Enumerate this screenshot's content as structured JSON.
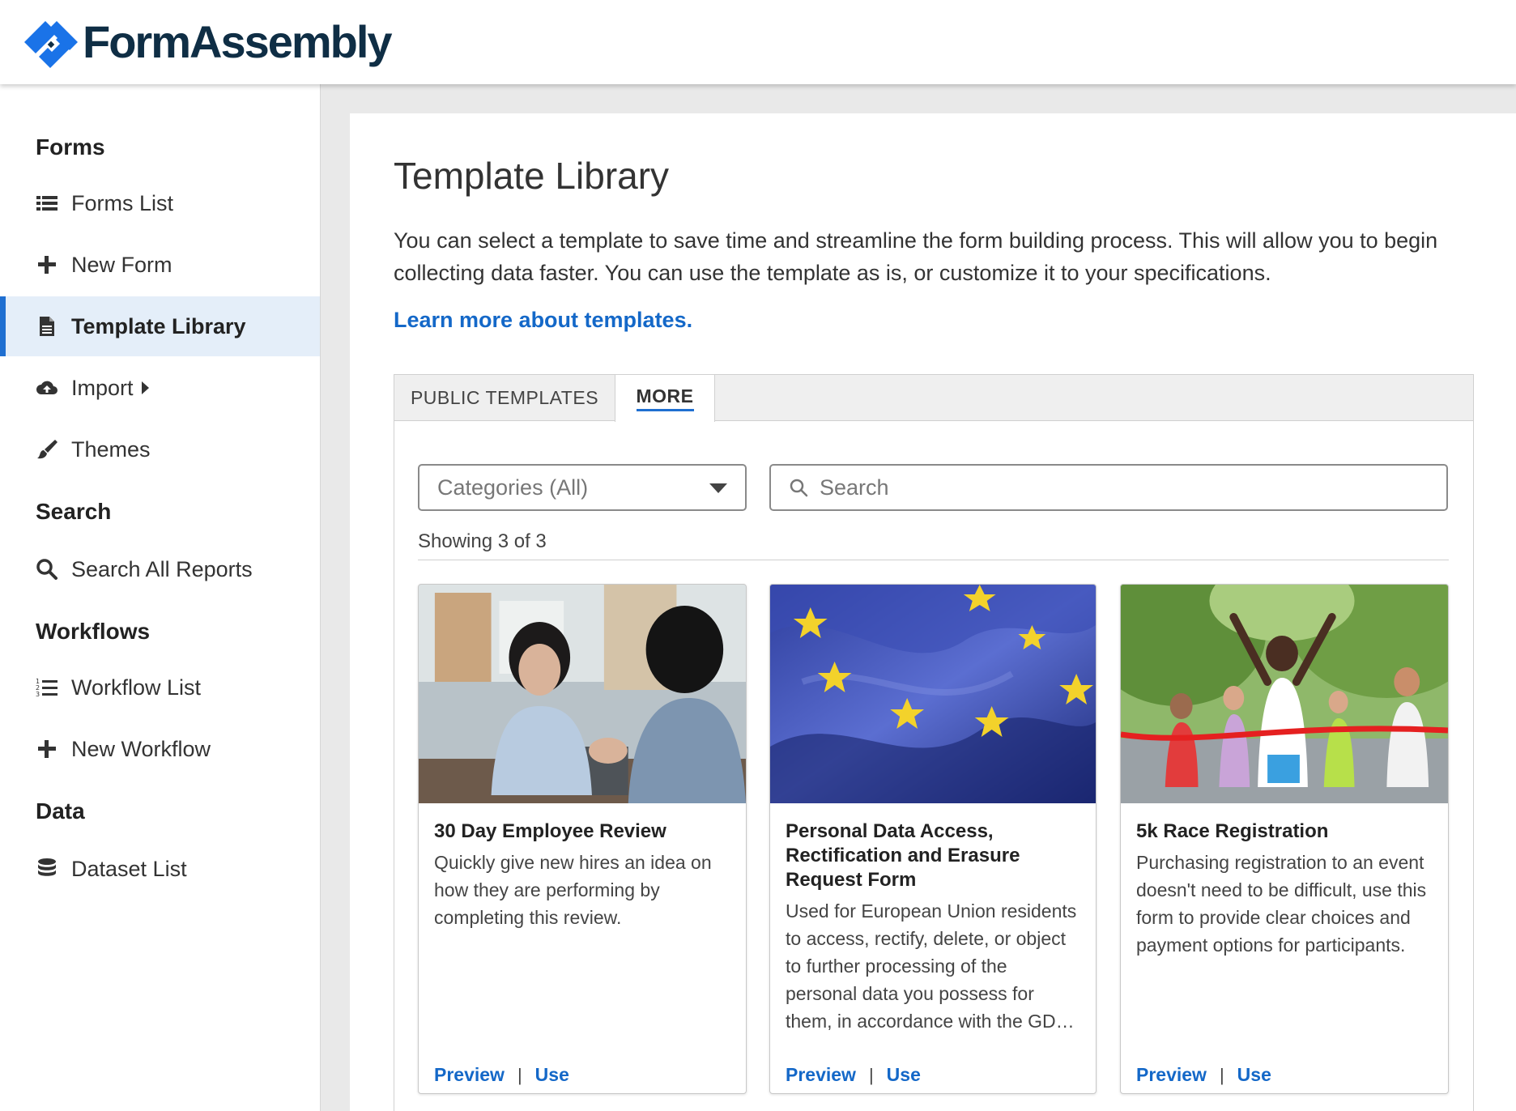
{
  "header": {
    "brand": "FormAssembly"
  },
  "sidebar": {
    "sections": [
      {
        "heading": "Forms",
        "items": [
          {
            "label": "Forms List",
            "icon": "list-icon"
          },
          {
            "label": "New Form",
            "icon": "plus-icon"
          },
          {
            "label": "Template Library",
            "icon": "document-icon",
            "active": true
          },
          {
            "label": "Import",
            "icon": "cloud-upload-icon"
          },
          {
            "label": "Themes",
            "icon": "paintbrush-icon"
          }
        ]
      },
      {
        "heading": "Search",
        "items": [
          {
            "label": "Search All Reports",
            "icon": "search-icon"
          }
        ]
      },
      {
        "heading": "Workflows",
        "items": [
          {
            "label": "Workflow List",
            "icon": "numbered-list-icon"
          },
          {
            "label": "New Workflow",
            "icon": "plus-icon"
          }
        ]
      },
      {
        "heading": "Data",
        "items": [
          {
            "label": "Dataset List",
            "icon": "database-icon"
          }
        ]
      }
    ]
  },
  "main": {
    "title": "Template Library",
    "description": "You can select a template to save time and streamline the form building process. This will allow you to begin collecting data faster. You can use the template as is, or customize it to your specifications.",
    "learn_more": "Learn more about templates.",
    "tabs": [
      {
        "label": "PUBLIC TEMPLATES"
      },
      {
        "label": "MORE",
        "active": true
      }
    ],
    "categories_select": "Categories (All)",
    "search_placeholder": "Search",
    "showing": "Showing 3 of 3",
    "cards": [
      {
        "title": "30 Day Employee Review",
        "description": "Quickly give new hires an idea on how they are performing by completing this review.",
        "preview": "Preview",
        "separator": "|",
        "use": "Use"
      },
      {
        "title": "Personal Data Access, Rectification and Erasure Request Form",
        "description": "Used for European Union residents to access, rectify, delete, or object to further processing of the personal data you possess for them, in accordance with the GD…",
        "preview": "Preview",
        "separator": "|",
        "use": "Use"
      },
      {
        "title": "5k Race Registration",
        "description": "Purchasing registration to an event doesn't need to be difficult, use this form to provide clear choices and payment options for participants.",
        "preview": "Preview",
        "separator": "|",
        "use": "Use"
      }
    ]
  },
  "colors": {
    "accent": "#1f6fd1",
    "link": "#1468c8",
    "brand_dark": "#0f2e45",
    "active_bg": "#e4eef9"
  }
}
